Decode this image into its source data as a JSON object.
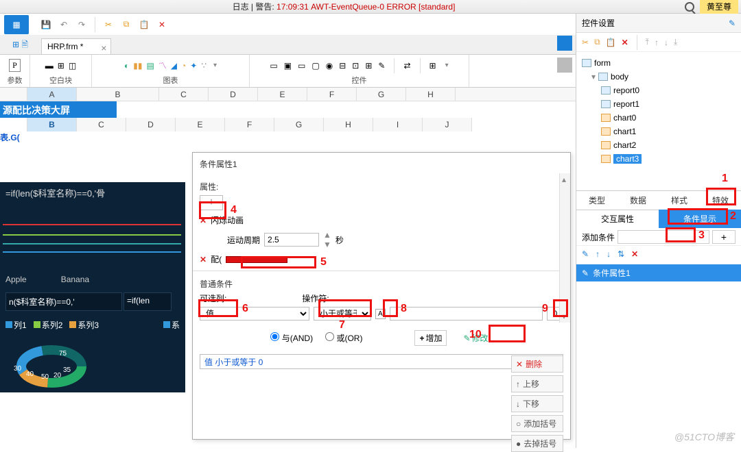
{
  "titlebar": {
    "prefix": "日志 | 警告:",
    "log": "17:09:31 AWT-EventQueue-0 ERROR [standard]",
    "username": "黄至尊"
  },
  "file_tab": {
    "name": "HRP.frm *",
    "close": "×"
  },
  "ribbon": {
    "g1": "参数",
    "g2": "空白块",
    "g3": "图表",
    "g4": "控件",
    "p_icon": "P"
  },
  "grid": {
    "cols1": [
      "A",
      "B",
      "C",
      "D",
      "E",
      "F",
      "G",
      "H"
    ],
    "cols2": [
      "B",
      "C",
      "D",
      "E",
      "F",
      "G",
      "H",
      "I",
      "J"
    ],
    "title_cell": "源配比决策大屏",
    "formula_label": "表.G(",
    "formula_text": "=if(len($科室名称)==0,'骨",
    "legend1": [
      "Apple",
      "Banana"
    ],
    "panel2_fx1": "n($科室名称)==0,'",
    "panel2_fx2": "=if(len",
    "series": [
      "列1",
      "系列2",
      "系列3",
      "系"
    ],
    "donut_vals": [
      "30",
      "40",
      "50",
      "20",
      "35",
      "75"
    ]
  },
  "right": {
    "title": "控件设置",
    "tree": {
      "root": "form",
      "body": "body",
      "r0": "report0",
      "r1": "report1",
      "c0": "chart0",
      "c1": "chart1",
      "c2": "chart2",
      "c3": "chart3"
    },
    "tabs": [
      "类型",
      "数据",
      "样式",
      "特效"
    ],
    "subtabs": [
      "交互属性",
      "条件显示"
    ],
    "add_label": "添加条件",
    "cond_item": "条件属性1"
  },
  "modal": {
    "title": "条件属性1",
    "attr_label": "属性:",
    "anim_name": "闪烁动画",
    "cycle_label": "运动周期",
    "cycle_val": "2.5",
    "cycle_unit": "秒",
    "normal_cond": "普通条件",
    "col_label": "可选列:",
    "op_label": "操作符:",
    "col_val": "值",
    "op_val": "小于或等于",
    "val_input": "0",
    "and": "与(AND)",
    "or": "或(OR)",
    "add": "增加",
    "modify": "修改",
    "cond_text": "值 小于或等于 0",
    "del": "删除",
    "up": "上移",
    "down": "下移",
    "addp": "添加括号",
    "remp": "去掉括号",
    "partial": "配( "
  },
  "ann": {
    "n1": "1",
    "n2": "2",
    "n3": "3",
    "n4": "4",
    "n5": "5",
    "n6": "6",
    "n7": "7",
    "n8": "8",
    "n9": "9",
    "n10": "10"
  },
  "watermark": "@51CTO博客"
}
